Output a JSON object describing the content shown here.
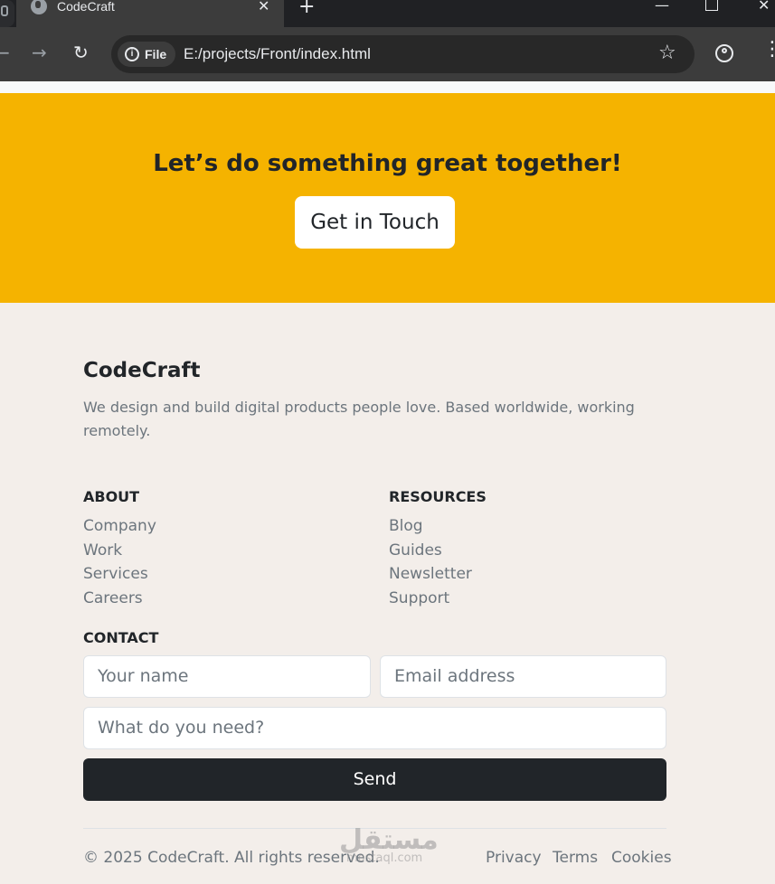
{
  "browser": {
    "tab_title": "CodeCraft",
    "tab_close": "✕",
    "new_tab": "+",
    "file_chip": "File",
    "url": "E:/projects/Front/index.html"
  },
  "cta": {
    "heading": "Let’s do something great together!",
    "button": "Get in Touch",
    "background": "#f5b300"
  },
  "footer": {
    "brand": "CodeCraft",
    "description": "We design and build digital products people love. Based worldwide, working remotely.",
    "about": {
      "heading": "ABOUT",
      "items": [
        "Company",
        "Work",
        "Services",
        "Careers"
      ]
    },
    "resources": {
      "heading": "RESOURCES",
      "items": [
        "Blog",
        "Guides",
        "Newsletter",
        "Support"
      ]
    },
    "contact": {
      "heading": "CONTACT",
      "name_placeholder": "Your name",
      "email_placeholder": "Email address",
      "need_placeholder": "What do you need?",
      "send": "Send"
    },
    "copyright": "© 2025 CodeCraft. All rights reserved.",
    "legal_links": [
      "Privacy",
      "Terms",
      "Cookies"
    ]
  },
  "watermark": {
    "arabic": "مستقل",
    "latin": "mostaql.com"
  }
}
